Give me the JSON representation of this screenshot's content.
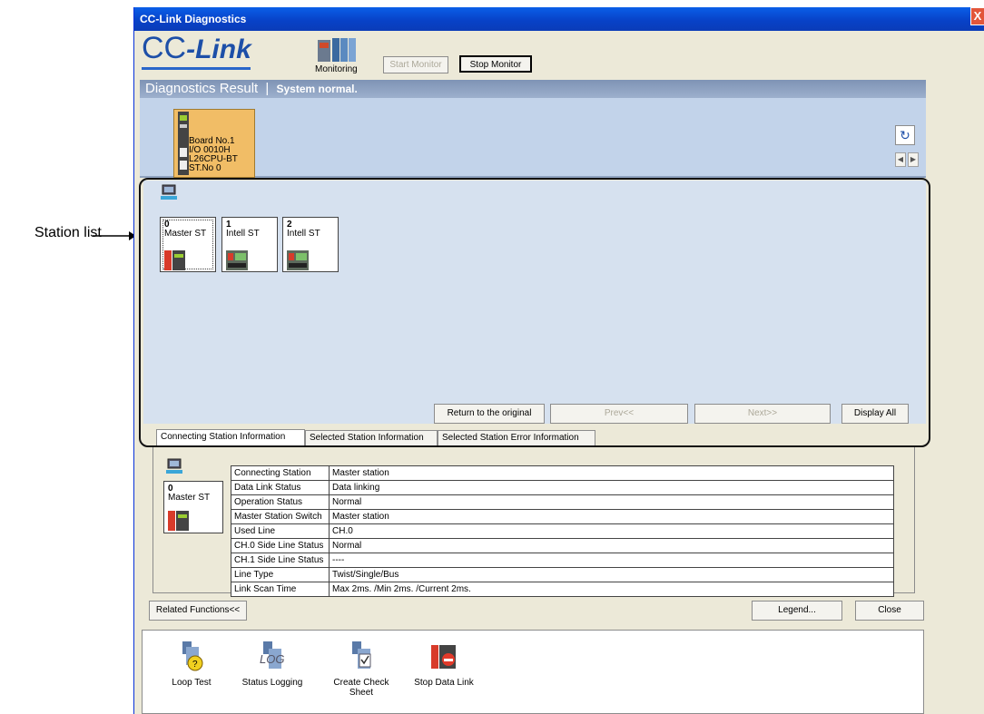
{
  "callout": {
    "label": "Station list"
  },
  "window": {
    "title": "CC-Link Diagnostics",
    "close_glyph": "X"
  },
  "logo": {
    "cc": "CC",
    "link": "-Link"
  },
  "toolbar": {
    "monitoring_label": "Monitoring",
    "start_monitor": "Start Monitor",
    "stop_monitor": "Stop Monitor"
  },
  "result": {
    "title": "Diagnostics Result",
    "separator": "|",
    "status": "System normal."
  },
  "board": {
    "lines": [
      "Board No.1",
      "I/O 0010H",
      "L26CPU-BT",
      "ST.No 0"
    ]
  },
  "stations": [
    {
      "number": "0",
      "label": "Master ST",
      "selected": true
    },
    {
      "number": "1",
      "label": "Intell ST",
      "selected": false
    },
    {
      "number": "2",
      "label": "Intell ST",
      "selected": false
    }
  ],
  "station_nav": {
    "return": "Return to the original",
    "prev": "Prev<<",
    "next": "Next>>",
    "display_all": "Display All"
  },
  "tabs": [
    {
      "label": "Connecting Station Information",
      "active": true
    },
    {
      "label": "Selected Station Information",
      "active": false
    },
    {
      "label": "Selected Station Error Information",
      "active": false
    }
  ],
  "info_card": {
    "number": "0",
    "label": "Master ST"
  },
  "info_rows": [
    {
      "key": "Connecting Station",
      "value": "Master station"
    },
    {
      "key": "Data Link Status",
      "value": "Data linking"
    },
    {
      "key": "Operation Status",
      "value": "Normal"
    },
    {
      "key": "Master Station Switch",
      "value": "Master station"
    },
    {
      "key": "Used Line",
      "value": "CH.0"
    },
    {
      "key": "CH.0 Side Line Status",
      "value": "Normal"
    },
    {
      "key": "CH.1 Side Line Status",
      "value": "----"
    },
    {
      "key": "Line Type",
      "value": "Twist/Single/Bus"
    },
    {
      "key": "Link Scan Time",
      "value": "Max 2ms. /Min 2ms. /Current 2ms."
    }
  ],
  "bottom_buttons": {
    "related_functions": "Related Functions<<",
    "legend": "Legend...",
    "close": "Close"
  },
  "functions": [
    {
      "label": "Loop Test",
      "icon": "loop-test-icon"
    },
    {
      "label": "Status Logging",
      "icon": "status-logging-icon"
    },
    {
      "label": "Create Check Sheet",
      "icon": "create-check-sheet-icon"
    },
    {
      "label": "Stop Data Link",
      "icon": "stop-data-link-icon"
    }
  ]
}
